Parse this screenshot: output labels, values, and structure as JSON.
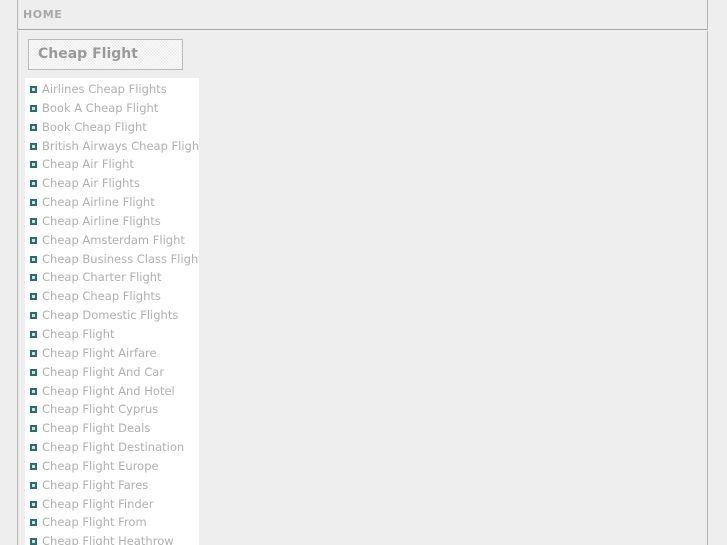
{
  "page": {
    "background_color": "#eeeeee",
    "border_color": "#b3b3b3"
  },
  "topbar": {
    "home_label": "HOME"
  },
  "heading": {
    "title": "Cheap Flight"
  },
  "link_list": {
    "bullet_icon": "square-bullet-icon",
    "bullet_color": "#2e6b6b",
    "text_color": "#b0b0b0",
    "items": [
      {
        "label": "Airlines Cheap Flights"
      },
      {
        "label": "Book A Cheap Flight"
      },
      {
        "label": "Book Cheap Flight"
      },
      {
        "label": "British Airways Cheap Flight"
      },
      {
        "label": "Cheap Air Flight"
      },
      {
        "label": "Cheap Air Flights"
      },
      {
        "label": "Cheap Airline Flight"
      },
      {
        "label": "Cheap Airline Flights"
      },
      {
        "label": "Cheap Amsterdam Flight"
      },
      {
        "label": "Cheap Business Class Flights"
      },
      {
        "label": "Cheap Charter Flight"
      },
      {
        "label": "Cheap Cheap Flights"
      },
      {
        "label": "Cheap Domestic Flights"
      },
      {
        "label": "Cheap Flight"
      },
      {
        "label": "Cheap Flight Airfare"
      },
      {
        "label": "Cheap Flight And Car"
      },
      {
        "label": "Cheap Flight And Hotel"
      },
      {
        "label": "Cheap Flight Cyprus"
      },
      {
        "label": "Cheap Flight Deals"
      },
      {
        "label": "Cheap Flight Destination"
      },
      {
        "label": "Cheap Flight Europe"
      },
      {
        "label": "Cheap Flight Fares"
      },
      {
        "label": "Cheap Flight Finder"
      },
      {
        "label": "Cheap Flight From"
      },
      {
        "label": "Cheap Flight Heathrow"
      }
    ]
  }
}
